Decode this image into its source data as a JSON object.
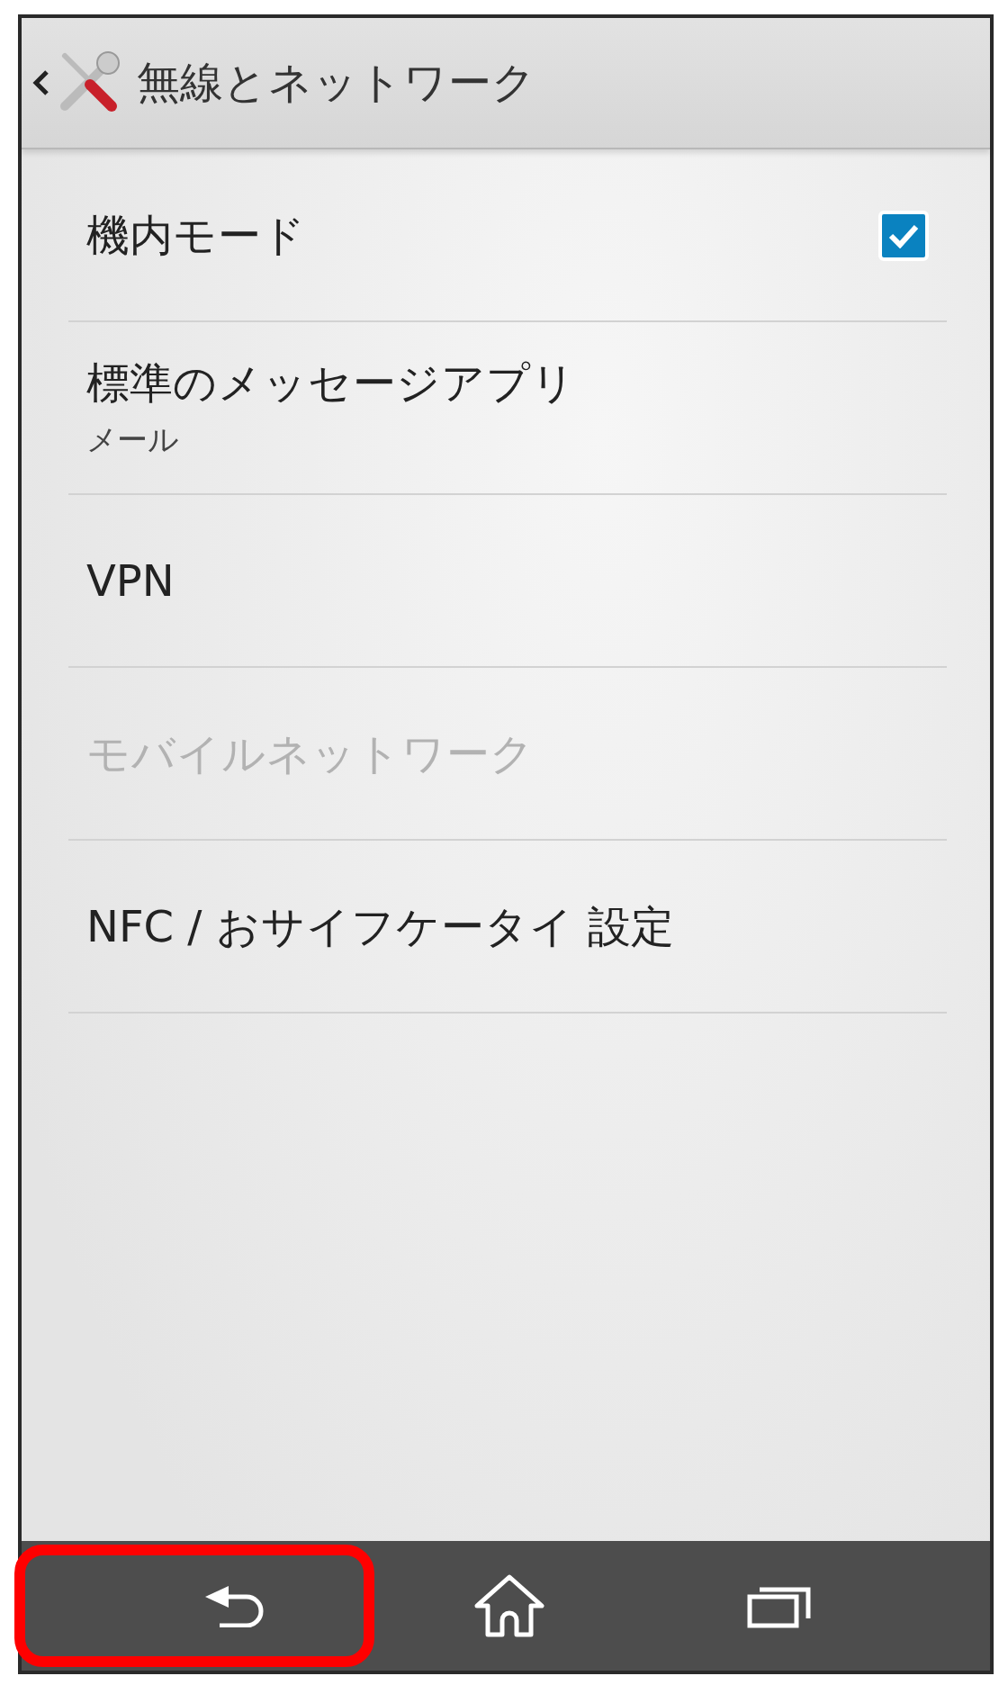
{
  "header": {
    "title": "無線とネットワーク"
  },
  "items": [
    {
      "kind": "checkbox",
      "title": "機内モード",
      "checked": true,
      "disabled": false
    },
    {
      "kind": "plain",
      "title": "標準のメッセージアプリ",
      "subtitle": "メール",
      "disabled": false
    },
    {
      "kind": "plain",
      "title": "VPN",
      "disabled": false
    },
    {
      "kind": "plain",
      "title": "モバイルネットワーク",
      "disabled": true
    },
    {
      "kind": "plain",
      "title": "NFC / おサイフケータイ 設定",
      "disabled": false
    }
  ],
  "nav_bar": {
    "buttons": [
      {
        "kind": "back",
        "highlighted": true
      },
      {
        "kind": "home",
        "highlighted": false
      },
      {
        "kind": "recents",
        "highlighted": false
      }
    ]
  }
}
